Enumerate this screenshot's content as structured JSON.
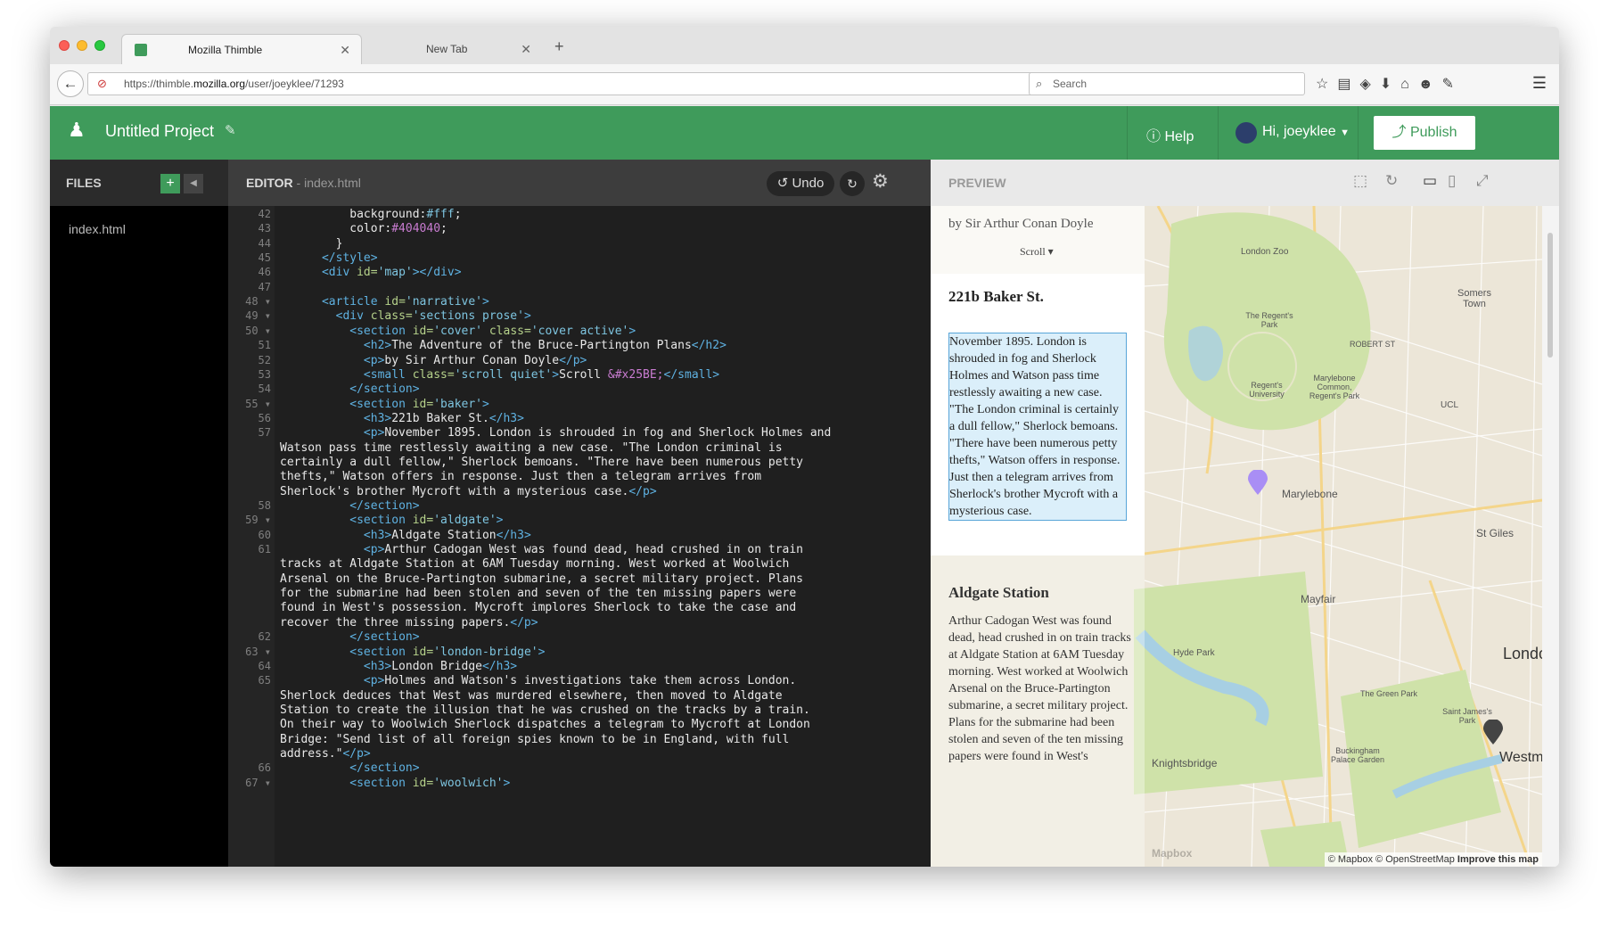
{
  "browser": {
    "tabs": [
      {
        "label": "Mozilla Thimble",
        "active": true
      },
      {
        "label": "New Tab",
        "active": false
      }
    ],
    "url_prefix": "https://thimble.",
    "url_domain": "mozilla.org",
    "url_path": "/user/joeyklee/71293",
    "search_placeholder": "Search"
  },
  "app": {
    "project_title": "Untitled Project",
    "help_label": "Help",
    "user_label": "Hi, joeyklee",
    "publish_label": "Publish",
    "brand_color": "#3f9b5b"
  },
  "files": {
    "header": "FILES",
    "items": [
      "index.html"
    ]
  },
  "editor": {
    "header": "EDITOR",
    "filename": "- index.html",
    "undo_label": "Undo",
    "lines": [
      {
        "n": "42",
        "h": "          background:<span class='st'>#fff</span>;"
      },
      {
        "n": "43",
        "h": "          color:<span class='ent'>#404040</span>;"
      },
      {
        "n": "44",
        "h": "        }"
      },
      {
        "n": "45",
        "h": "      <span class='tg'>&lt;/style&gt;</span>"
      },
      {
        "n": "46",
        "h": "      <span class='tg'>&lt;div</span> <span class='at'>id=</span><span class='st'>'map'</span><span class='tg'>&gt;&lt;/div&gt;</span>"
      },
      {
        "n": "47",
        "h": ""
      },
      {
        "n": "48 ▾",
        "h": "      <span class='tg'>&lt;article</span> <span class='at'>id=</span><span class='st'>'narrative'</span><span class='tg'>&gt;</span>"
      },
      {
        "n": "49 ▾",
        "h": "        <span class='tg'>&lt;div</span> <span class='at'>class=</span><span class='st'>'sections prose'</span><span class='tg'>&gt;</span>"
      },
      {
        "n": "50 ▾",
        "h": "          <span class='tg'>&lt;section</span> <span class='at'>id=</span><span class='st'>'cover'</span> <span class='at'>class=</span><span class='st'>'cover active'</span><span class='tg'>&gt;</span>"
      },
      {
        "n": "51",
        "h": "            <span class='tg'>&lt;h2&gt;</span>The Adventure of the Bruce-Partington Plans<span class='tg'>&lt;/h2&gt;</span>"
      },
      {
        "n": "52",
        "h": "            <span class='tg'>&lt;p&gt;</span>by Sir Arthur Conan Doyle<span class='tg'>&lt;/p&gt;</span>"
      },
      {
        "n": "53",
        "h": "            <span class='tg'>&lt;small</span> <span class='at'>class=</span><span class='st'>'scroll quiet'</span><span class='tg'>&gt;</span>Scroll <span class='ent'>&amp;#x25BE;</span><span class='tg'>&lt;/small&gt;</span>"
      },
      {
        "n": "54",
        "h": "          <span class='tg'>&lt;/section&gt;</span>"
      },
      {
        "n": "55 ▾",
        "h": "          <span class='tg'>&lt;section</span> <span class='at'>id=</span><span class='st'>'baker'</span><span class='tg'>&gt;</span>"
      },
      {
        "n": "56",
        "h": "            <span class='tg'>&lt;h3&gt;</span>221b Baker St.<span class='tg'>&lt;/h3&gt;</span>"
      },
      {
        "n": "57",
        "h": "            <span class='tg'>&lt;p&gt;</span>November 1895. London is shrouded in fog and Sherlock Holmes and"
      },
      {
        "n": "",
        "h": "Watson pass time restlessly awaiting a new case. \"The London criminal is"
      },
      {
        "n": "",
        "h": "certainly a dull fellow,\" Sherlock bemoans. \"There have been numerous petty"
      },
      {
        "n": "",
        "h": "thefts,\" Watson offers in response. Just then a telegram arrives from"
      },
      {
        "n": "",
        "h": "Sherlock's brother Mycroft with a mysterious case.<span class='tg'>&lt;/p&gt;</span>"
      },
      {
        "n": "58",
        "h": "          <span class='tg'>&lt;/section&gt;</span>"
      },
      {
        "n": "59 ▾",
        "h": "          <span class='tg'>&lt;section</span> <span class='at'>id=</span><span class='st'>'aldgate'</span><span class='tg'>&gt;</span>"
      },
      {
        "n": "60",
        "h": "            <span class='tg'>&lt;h3&gt;</span>Aldgate Station<span class='tg'>&lt;/h3&gt;</span>"
      },
      {
        "n": "61",
        "h": "            <span class='tg'>&lt;p&gt;</span>Arthur Cadogan West was found dead, head crushed in on train"
      },
      {
        "n": "",
        "h": "tracks at Aldgate Station at 6AM Tuesday morning. West worked at Woolwich"
      },
      {
        "n": "",
        "h": "Arsenal on the Bruce-Partington submarine, a secret military project. Plans"
      },
      {
        "n": "",
        "h": "for the submarine had been stolen and seven of the ten missing papers were"
      },
      {
        "n": "",
        "h": "found in West's possession. Mycroft implores Sherlock to take the case and"
      },
      {
        "n": "",
        "h": "recover the three missing papers.<span class='tg'>&lt;/p&gt;</span>"
      },
      {
        "n": "62",
        "h": "          <span class='tg'>&lt;/section&gt;</span>"
      },
      {
        "n": "63 ▾",
        "h": "          <span class='tg'>&lt;section</span> <span class='at'>id=</span><span class='st'>'london-bridge'</span><span class='tg'>&gt;</span>"
      },
      {
        "n": "64",
        "h": "            <span class='tg'>&lt;h3&gt;</span>London Bridge<span class='tg'>&lt;/h3&gt;</span>"
      },
      {
        "n": "65",
        "h": "            <span class='tg'>&lt;p&gt;</span>Holmes and Watson's investigations take them across London."
      },
      {
        "n": "",
        "h": "Sherlock deduces that West was murdered elsewhere, then moved to Aldgate"
      },
      {
        "n": "",
        "h": "Station to create the illusion that he was crushed on the tracks by a train."
      },
      {
        "n": "",
        "h": "On their way to Woolwich Sherlock dispatches a telegram to Mycroft at London"
      },
      {
        "n": "",
        "h": "Bridge: \"Send list of all foreign spies known to be in England, with full"
      },
      {
        "n": "",
        "h": "address.\"<span class='tg'>&lt;/p&gt;</span>"
      },
      {
        "n": "66",
        "h": "          <span class='tg'>&lt;/section&gt;</span>"
      },
      {
        "n": "67 ▾",
        "h": "          <span class='tg'>&lt;section</span> <span class='at'>id=</span><span class='st'>'woolwich'</span><span class='tg'>&gt;</span>"
      }
    ]
  },
  "preview": {
    "header": "PREVIEW",
    "byline": "by Sir Arthur Conan Doyle",
    "scroll_label": "Scroll ▾",
    "baker_title": "221b Baker St.",
    "baker_text": "November 1895. London is shrouded in fog and Sherlock Holmes and Watson pass time restlessly awaiting a new case. \"The London criminal is certainly a dull fellow,\" Sherlock bemoans. \"There have been numerous petty thefts,\" Watson offers in response. Just then a telegram arrives from Sherlock's brother Mycroft with a mysterious case.",
    "aldgate_title": "Aldgate Station",
    "aldgate_text": "Arthur Cadogan West was found dead, head crushed in on train tracks at Aldgate Station at 6AM Tuesday morning. West worked at Woolwich Arsenal on the Bruce-Partington submarine, a secret military project. Plans for the submarine had been stolen and seven of the ten missing papers were found in West's",
    "map_labels": {
      "london_zoo": "London Zoo",
      "regents_park": "The Regent's Park",
      "somers_town": "Somers Town",
      "robert_st": "ROBERT ST",
      "ucl": "UCL",
      "regents_univ": "Regent's University",
      "marylebone_common": "Marylebone Common, Regent's Park",
      "marylebone": "Marylebone",
      "st_giles": "St Giles",
      "mayfair": "Mayfair",
      "hyde_park": "Hyde Park",
      "london": "London",
      "green_park": "The Green Park",
      "st_james": "Saint James's Park",
      "buckingham": "Buckingham Palace Garden",
      "knightsbridge": "Knightsbridge",
      "westmin": "Westmin",
      "mapbox": "Mapbox"
    },
    "attribution_prefix": "© Mapbox © OpenStreetMap",
    "attribution_link": "Improve this map"
  }
}
